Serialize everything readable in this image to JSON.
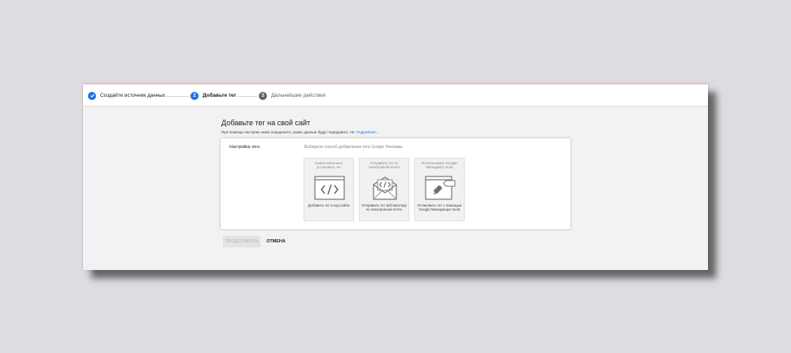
{
  "stepper": {
    "steps": [
      {
        "label": "Создайте источник данных",
        "state": "done",
        "icon": "check-icon"
      },
      {
        "label": "Добавьте тег",
        "state": "active",
        "number": "2"
      },
      {
        "label": "Дальнейшие действия",
        "state": "pending",
        "number": "3"
      }
    ]
  },
  "main": {
    "title": "Добавьте тег на свой сайт",
    "subtitle_text": "При помощи настроек ниже определите, какие данные будут передавать тег.",
    "subtitle_link": "Подробнее..."
  },
  "tag_settings": {
    "label": "Настройка тега",
    "hint": "Выберите способ добавления тега Google Рекламы",
    "options": [
      {
        "top": "Самостоятельно установить тег",
        "bottom": "Добавить тег в код сайта",
        "icon": "code-window-icon"
      },
      {
        "top": "Отправить тег по электронной почте",
        "bottom": "Отправить тег веб-мастеру по электронной почте",
        "icon": "email-code-icon"
      },
      {
        "top": "Использовать Google Менеджер тегов",
        "bottom": "Установить тег с помощью Google Менеджера тегов",
        "icon": "tag-manager-icon"
      }
    ]
  },
  "actions": {
    "continue": "ПРОДОЛЖИТЬ",
    "cancel": "ОТМЕНА"
  },
  "colors": {
    "accent": "#1a73e8",
    "pending_step": "#5f6368",
    "background": "#f1f2f4"
  }
}
